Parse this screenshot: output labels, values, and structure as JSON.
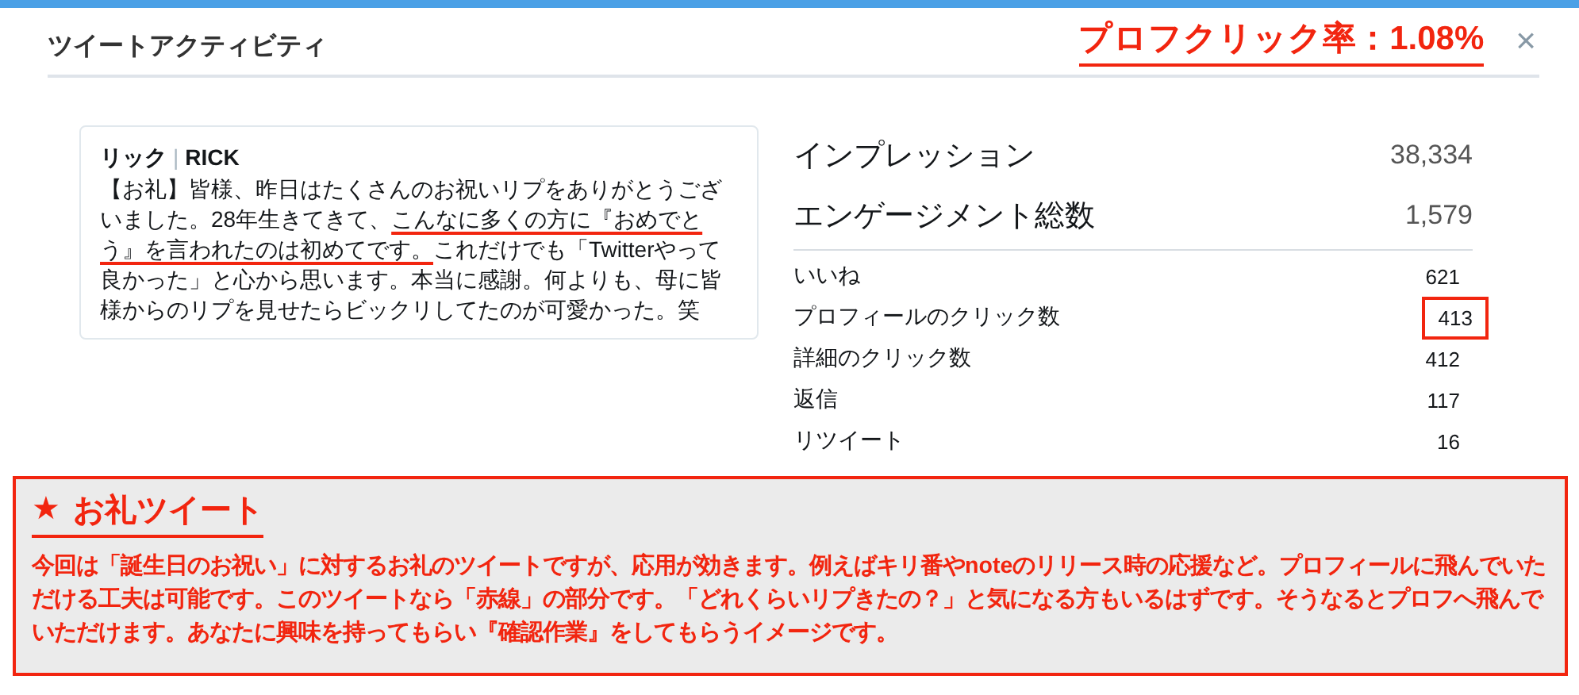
{
  "dialog": {
    "title": "ツイートアクティビティ",
    "close": "×"
  },
  "annotation_headline": {
    "text": "プロフクリック率：1.08%",
    "underlined": true
  },
  "tweet": {
    "author": "リック",
    "separator": "|",
    "handle": "RICK",
    "segments": [
      {
        "text": "【お礼】皆様、昨日はたくさんのお祝いリプをありがとうございました。28年生きてきて、",
        "underlined": false
      },
      {
        "text": "こんなに多くの方に『おめでとう』を言われたのは初めてです。",
        "underlined": true
      },
      {
        "text": "これだけでも「Twitterやって良かった」と心から思います。本当に感謝。何よりも、母に皆様からのリプを見せたらビックリしてたのが可愛かった。笑",
        "underlined": false
      }
    ]
  },
  "summary": [
    {
      "label": "インプレッション",
      "value": "38,334"
    },
    {
      "label": "エンゲージメント総数",
      "value": "1,579"
    }
  ],
  "metrics": [
    {
      "label": "いいね",
      "value": "621",
      "highlighted": false
    },
    {
      "label": "プロフィールのクリック数",
      "value": "413",
      "highlighted": true
    },
    {
      "label": "詳細のクリック数",
      "value": "412",
      "highlighted": false
    },
    {
      "label": "返信",
      "value": "117",
      "highlighted": false
    },
    {
      "label": "リツイート",
      "value": "16",
      "highlighted": false
    }
  ],
  "callout": {
    "star": "★",
    "title": "お礼ツイート",
    "body": "今回は「誕生日のお祝い」に対するお礼のツイートですが、応用が効きます。例えばキリ番やnoteのリリース時の応援など。プロフィールに飛んでいただける工夫は可能です。このツイートなら「赤線」の部分です。「どれくらいリプきたの？」と気になる方もいるはずです。そうなるとプロフへ飛んでいただけます。あなたに興味を持ってもらい『確認作業』をしてもらうイメージです。"
  }
}
